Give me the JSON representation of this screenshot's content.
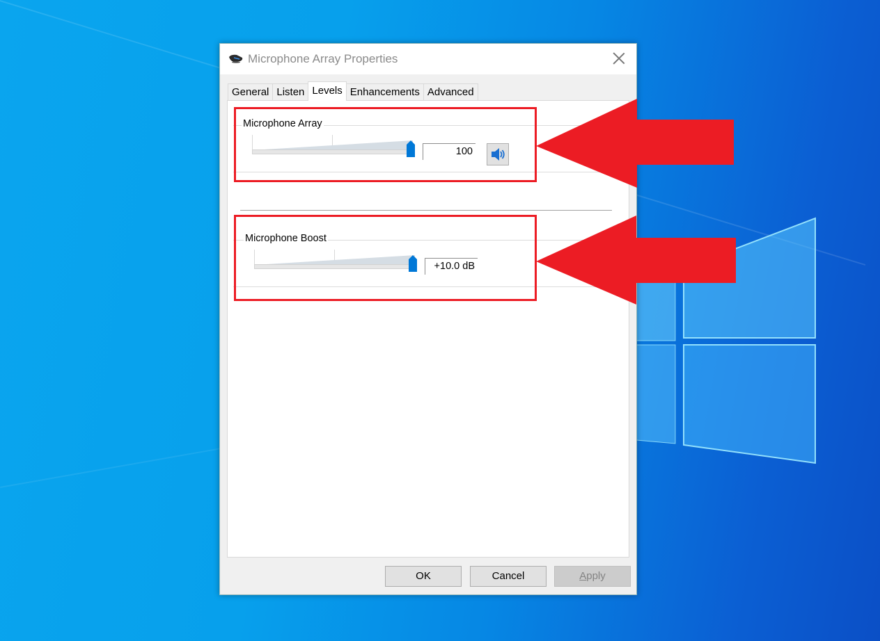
{
  "window": {
    "title": "Microphone Array Properties",
    "icon": "microphone-array-icon",
    "close_icon": "close-icon"
  },
  "tabs": [
    {
      "label": "General",
      "active": false
    },
    {
      "label": "Listen",
      "active": false
    },
    {
      "label": "Levels",
      "active": true
    },
    {
      "label": "Enhancements",
      "active": false
    },
    {
      "label": "Advanced",
      "active": false
    }
  ],
  "levels": {
    "microphone_array": {
      "label": "Microphone Array",
      "value_text": "100",
      "slider_percent": 100,
      "mute_icon": "speaker-icon"
    },
    "microphone_boost": {
      "label": "Microphone Boost",
      "value_text": "+10.0 dB",
      "slider_percent": 100
    }
  },
  "buttons": {
    "ok": "OK",
    "cancel": "Cancel",
    "apply": "Apply",
    "apply_enabled": false
  },
  "annotations": {
    "highlight_color": "#ec1c24",
    "arrows": [
      "arrow-pointing-to-microphone-array",
      "arrow-pointing-to-microphone-boost"
    ]
  },
  "colors": {
    "slider_thumb": "#0078d7",
    "desktop_blue": "#0a9fec"
  }
}
